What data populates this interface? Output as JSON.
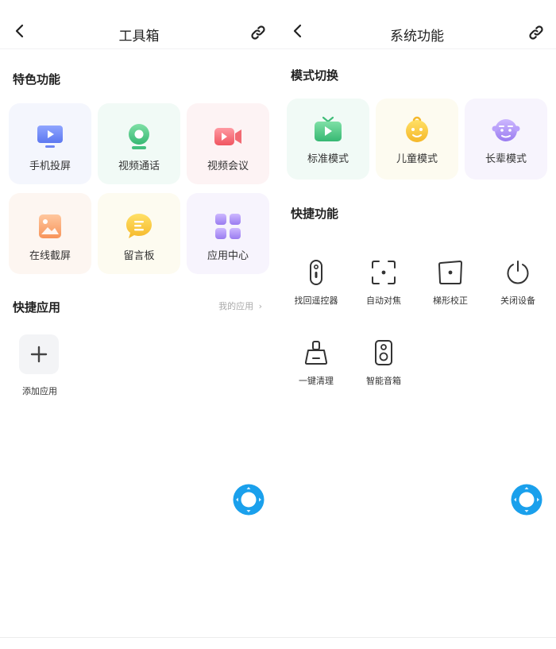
{
  "left": {
    "header": {
      "title": "工具箱"
    },
    "featured": {
      "title": "特色功能",
      "items": [
        {
          "label": "手机投屏",
          "icon": "screen-cast-icon"
        },
        {
          "label": "视频通话",
          "icon": "webcam-icon"
        },
        {
          "label": "视频会议",
          "icon": "video-camera-icon"
        },
        {
          "label": "在线截屏",
          "icon": "image-icon"
        },
        {
          "label": "留言板",
          "icon": "message-bubble-icon"
        },
        {
          "label": "应用中心",
          "icon": "app-grid-icon"
        }
      ]
    },
    "quick_apps": {
      "title": "快捷应用",
      "more_label": "我的应用",
      "add_label": "添加应用"
    }
  },
  "right": {
    "header": {
      "title": "系统功能"
    },
    "modes": {
      "title": "模式切换",
      "items": [
        {
          "label": "标准模式",
          "icon": "tv-icon"
        },
        {
          "label": "儿童模式",
          "icon": "child-face-icon"
        },
        {
          "label": "长辈模式",
          "icon": "elder-face-icon"
        }
      ]
    },
    "shortcuts": {
      "title": "快捷功能",
      "items": [
        {
          "label": "找回遥控器",
          "icon": "remote-icon"
        },
        {
          "label": "自动对焦",
          "icon": "focus-icon"
        },
        {
          "label": "梯形校正",
          "icon": "keystone-icon"
        },
        {
          "label": "关闭设备",
          "icon": "power-icon"
        },
        {
          "label": "一键清理",
          "icon": "broom-icon"
        },
        {
          "label": "智能音箱",
          "icon": "speaker-icon"
        }
      ]
    }
  },
  "colors": {
    "accent_blue": "#1aa0ec",
    "tile_blue": "#f4f6fd",
    "tile_green": "#f1faf6",
    "tile_red": "#fdf3f4",
    "tile_orange": "#fdf6f1",
    "tile_yellow": "#fdfbf0",
    "tile_purple": "#f7f4fd"
  }
}
